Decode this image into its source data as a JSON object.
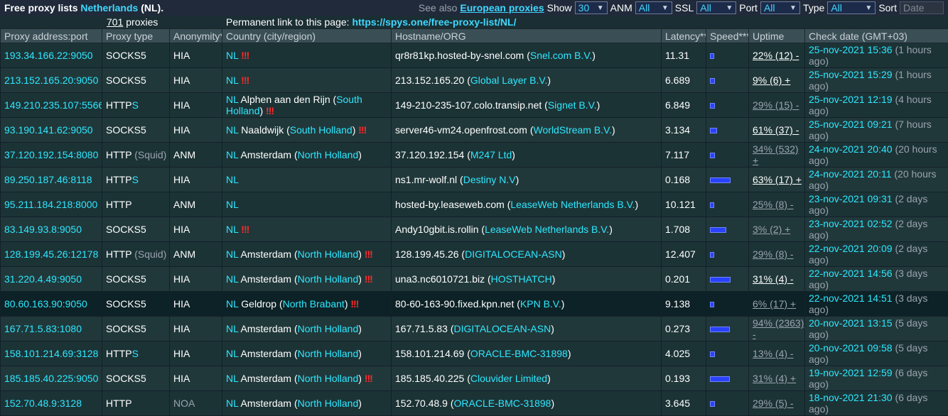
{
  "header": {
    "title_prefix": "Free proxy lists",
    "country": "Netherlands",
    "title_suffix": "(NL).",
    "see_also": "See also",
    "european_link": "European proxies",
    "show_label": "Show",
    "show_value": "30",
    "anm_label": "ANM",
    "anm_value": "All",
    "ssl_label": "SSL",
    "ssl_value": "All",
    "port_label": "Port",
    "port_value": "All",
    "type_label": "Type",
    "type_value": "All",
    "sort_label": "Sort",
    "sort_value": "Date"
  },
  "info": {
    "count": "701",
    "count_suffix": " proxies",
    "perm_label": "Permanent link to this page:",
    "perm_url": "https://spys.one/free-proxy-list/NL/"
  },
  "columns": [
    "Proxy address:port",
    "Proxy type",
    "Anonymity*",
    "Country (city/region)",
    "Hostname/ORG",
    "Latency**",
    "Speed***",
    "Uptime",
    "Check date (GMT+03)"
  ],
  "colors": {
    "accent": "#2ee8ff",
    "danger": "#ff2a2a",
    "speed": "#2a42ff"
  },
  "rows": [
    {
      "ip": "193.34.166.22:9050",
      "type": "SOCKS5",
      "type_suffix": "",
      "type_extra": "",
      "anon": "HIA",
      "country": "NL",
      "city": "",
      "region": "",
      "flag": "!!!",
      "host": "qr8r81kp.hosted-by-snel.com",
      "org": "Snel.com B.V.",
      "latency": "11.31",
      "speed": 0.1,
      "uptime": "22% (12) -",
      "uptime_good": true,
      "date": "25-nov-2021 15:36",
      "ago": "(1 hours ago)"
    },
    {
      "ip": "213.152.165.20:9050",
      "type": "SOCKS5",
      "type_suffix": "",
      "type_extra": "",
      "anon": "HIA",
      "country": "NL",
      "city": "",
      "region": "",
      "flag": "!!!",
      "host": "213.152.165.20",
      "org": "Global Layer B.V.",
      "latency": "6.689",
      "speed": 0.15,
      "uptime": "9% (6) +",
      "uptime_good": true,
      "date": "25-nov-2021 15:29",
      "ago": "(1 hours ago)"
    },
    {
      "ip": "149.210.235.107:5566",
      "type": "HTTP",
      "type_suffix": "S",
      "type_extra": "",
      "anon": "HIA",
      "country": "NL",
      "city": "Alphen aan den Rijn",
      "region": "South Holland",
      "flag": "!!!",
      "host": "149-210-235-107.colo.transip.net",
      "org": "Signet B.V.",
      "latency": "6.849",
      "speed": 0.15,
      "uptime": "29% (15) -",
      "uptime_good": false,
      "date": "25-nov-2021 12:19",
      "ago": "(4 hours ago)"
    },
    {
      "ip": "93.190.141.62:9050",
      "type": "SOCKS5",
      "type_suffix": "",
      "type_extra": "",
      "anon": "HIA",
      "country": "NL",
      "city": "Naaldwijk",
      "region": "South Holland",
      "flag": "!!!",
      "host": "server46-vm24.openfrost.com",
      "org": "WorldStream B.V.",
      "latency": "3.134",
      "speed": 0.25,
      "uptime": "61% (37) -",
      "uptime_good": true,
      "date": "25-nov-2021 09:21",
      "ago": "(7 hours ago)"
    },
    {
      "ip": "37.120.192.154:8080",
      "type": "HTTP",
      "type_suffix": "",
      "type_extra": "(Squid)",
      "anon": "ANM",
      "country": "NL",
      "city": "Amsterdam",
      "region": "North Holland",
      "flag": "",
      "host": "37.120.192.154",
      "org": "M247 Ltd",
      "latency": "7.117",
      "speed": 0.15,
      "uptime": "34% (532) +",
      "uptime_good": false,
      "date": "24-nov-2021 20:40",
      "ago": "(20 hours ago)"
    },
    {
      "ip": "89.250.187.46:8118",
      "type": "HTTP",
      "type_suffix": "S",
      "type_extra": "",
      "anon": "HIA",
      "country": "NL",
      "city": "",
      "region": "",
      "flag": "",
      "host": "ns1.mr-wolf.nl",
      "org": "Destiny N.V",
      "latency": "0.168",
      "speed": 0.9,
      "uptime": "63% (17) +",
      "uptime_good": true,
      "date": "24-nov-2021 20:11",
      "ago": "(20 hours ago)"
    },
    {
      "ip": "95.211.184.218:8000",
      "type": "HTTP",
      "type_suffix": "",
      "type_extra": "",
      "anon": "ANM",
      "country": "NL",
      "city": "",
      "region": "",
      "flag": "",
      "host": "hosted-by.leaseweb.com",
      "org": "LeaseWeb Netherlands B.V.",
      "latency": "10.121",
      "speed": 0.1,
      "uptime": "25% (8) -",
      "uptime_good": false,
      "date": "23-nov-2021 09:31",
      "ago": "(2 days ago)"
    },
    {
      "ip": "83.149.93.8:9050",
      "type": "SOCKS5",
      "type_suffix": "",
      "type_extra": "",
      "anon": "HIA",
      "country": "NL",
      "city": "",
      "region": "",
      "flag": "!!!",
      "host": "Andy10gbit.is.rollin",
      "org": "LeaseWeb Netherlands B.V.",
      "latency": "1.708",
      "speed": 0.7,
      "uptime": "3% (2) +",
      "uptime_good": false,
      "date": "23-nov-2021 02:52",
      "ago": "(2 days ago)"
    },
    {
      "ip": "128.199.45.26:12178",
      "type": "HTTP",
      "type_suffix": "",
      "type_extra": "(Squid)",
      "anon": "ANM",
      "country": "NL",
      "city": "Amsterdam",
      "region": "North Holland",
      "flag": "!!!",
      "host": "128.199.45.26",
      "org": "DIGITALOCEAN-ASN",
      "latency": "12.407",
      "speed": 0.08,
      "uptime": "29% (8) -",
      "uptime_good": false,
      "date": "22-nov-2021 20:09",
      "ago": "(2 days ago)"
    },
    {
      "ip": "31.220.4.49:9050",
      "type": "SOCKS5",
      "type_suffix": "",
      "type_extra": "",
      "anon": "HIA",
      "country": "NL",
      "city": "Amsterdam",
      "region": "North Holland",
      "flag": "!!!",
      "host": "una3.nc6010721.biz",
      "org": "HOSTHATCH",
      "latency": "0.201",
      "speed": 0.9,
      "uptime": "31% (4) -",
      "uptime_good": true,
      "date": "22-nov-2021 14:56",
      "ago": "(3 days ago)"
    },
    {
      "ip": "80.60.163.90:9050",
      "type": "SOCKS5",
      "type_suffix": "",
      "type_extra": "",
      "anon": "HIA",
      "country": "NL",
      "city": "Geldrop",
      "region": "North Brabant",
      "flag": "!!!",
      "host": "80-60-163-90.fixed.kpn.net",
      "org": "KPN B.V.",
      "latency": "9.138",
      "speed": 0.1,
      "uptime": "6% (17) +",
      "uptime_good": false,
      "date": "22-nov-2021 14:51",
      "ago": "(3 days ago)"
    },
    {
      "ip": "167.71.5.83:1080",
      "type": "SOCKS5",
      "type_suffix": "",
      "type_extra": "",
      "anon": "HIA",
      "country": "NL",
      "city": "Amsterdam",
      "region": "North Holland",
      "flag": "",
      "host": "167.71.5.83",
      "org": "DIGITALOCEAN-ASN",
      "latency": "0.273",
      "speed": 0.85,
      "uptime": "94% (2363) -",
      "uptime_good": false,
      "date": "20-nov-2021 13:15",
      "ago": "(5 days ago)"
    },
    {
      "ip": "158.101.214.69:3128",
      "type": "HTTP",
      "type_suffix": "S",
      "type_extra": "",
      "anon": "HIA",
      "country": "NL",
      "city": "Amsterdam",
      "region": "North Holland",
      "flag": "",
      "host": "158.101.214.69",
      "org": "ORACLE-BMC-31898",
      "latency": "4.025",
      "speed": 0.15,
      "uptime": "13% (4) -",
      "uptime_good": false,
      "date": "20-nov-2021 09:58",
      "ago": "(5 days ago)"
    },
    {
      "ip": "185.185.40.225:9050",
      "type": "SOCKS5",
      "type_suffix": "",
      "type_extra": "",
      "anon": "HIA",
      "country": "NL",
      "city": "Amsterdam",
      "region": "North Holland",
      "flag": "!!!",
      "host": "185.185.40.225",
      "org": "Clouvider Limited",
      "latency": "0.193",
      "speed": 0.85,
      "uptime": "31% (4) +",
      "uptime_good": false,
      "date": "19-nov-2021 12:59",
      "ago": "(6 days ago)"
    },
    {
      "ip": "152.70.48.9:3128",
      "type": "HTTP",
      "type_suffix": "",
      "type_extra": "",
      "anon": "NOA",
      "country": "NL",
      "city": "Amsterdam",
      "region": "North Holland",
      "flag": "",
      "host": "152.70.48.9",
      "org": "ORACLE-BMC-31898",
      "latency": "3.645",
      "speed": 0.15,
      "uptime": "29% (5) -",
      "uptime_good": false,
      "date": "18-nov-2021 21:30",
      "ago": "(6 days ago)"
    }
  ]
}
